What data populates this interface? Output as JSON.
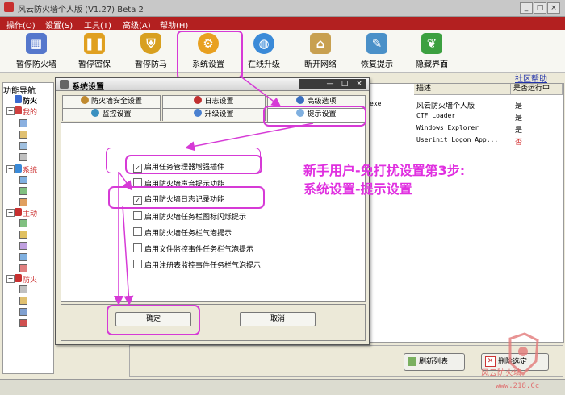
{
  "window": {
    "title": "风云防火墙个人版  (V1.27)  Beta 2",
    "controls": [
      "_",
      "□",
      "×"
    ]
  },
  "menu": [
    "操作(O)",
    "设置(S)",
    "工具(T)",
    "高级(A)",
    "帮助(H)"
  ],
  "toolbar": [
    {
      "label": "暂停防火墙",
      "icon": "firewall-pause-icon",
      "color": "#5577cc"
    },
    {
      "label": "暂停密保",
      "icon": "password-pause-icon",
      "color": "#e0a020"
    },
    {
      "label": "暂停防马",
      "icon": "shield-icon",
      "color": "#d8a020"
    },
    {
      "label": "系统设置",
      "icon": "gear-icon",
      "color": "#e8a020"
    },
    {
      "label": "在线升级",
      "icon": "globe-icon",
      "color": "#3a8ad8"
    },
    {
      "label": "断开网络",
      "icon": "network-icon",
      "color": "#c8a050"
    },
    {
      "label": "恢复提示",
      "icon": "restore-icon",
      "color": "#4a90c8"
    },
    {
      "label": "隐藏界面",
      "icon": "leaf-icon",
      "color": "#3ca040"
    }
  ],
  "community_help": "社区帮助",
  "nav": {
    "title": "功能导航",
    "nodes": [
      "防火",
      "我的",
      "系统",
      "主动",
      "防火"
    ]
  },
  "list": {
    "headers": [
      "描述",
      "是否运行中"
    ],
    "rows": [
      {
        "file": "exe",
        "desc": "风云防火墙个人版",
        "running": "是"
      },
      {
        "file": "",
        "desc": "CTF Loader",
        "running": "是"
      },
      {
        "file": "",
        "desc": "Windows Explorer",
        "running": "是"
      },
      {
        "file": "",
        "desc": "Userinit Logon App...",
        "running": "否"
      }
    ]
  },
  "bottom_buttons": {
    "refresh": "刷新列表",
    "delete": "删除选定"
  },
  "dialog": {
    "title": "系统设置",
    "controls": [
      "—",
      "□",
      "×"
    ],
    "tabs_row1": [
      "防火墙安全设置",
      "日志设置",
      "高级选项"
    ],
    "tabs_row2": [
      "监控设置",
      "升级设置",
      "提示设置"
    ],
    "options": [
      {
        "label": "启用任务管理器增强插件",
        "checked": true
      },
      {
        "label": "启用防火墙声音提示功能",
        "checked": false
      },
      {
        "label": "启用防火墙日志记录功能",
        "checked": true
      },
      {
        "label": "启用防火墙任务栏图标闪烁提示",
        "checked": false
      },
      {
        "label": "启用防火墙任务栏气泡提示",
        "checked": false
      },
      {
        "label": "启用文件监控事件任务栏气泡提示",
        "checked": false
      },
      {
        "label": "启用注册表监控事件任务栏气泡提示",
        "checked": false
      }
    ],
    "ok": "确定",
    "cancel": "取消"
  },
  "annotation": {
    "line1": "新手用户-免打扰设置第3步:",
    "line2": "系统设置-提示设置"
  },
  "watermark": {
    "text": "风云防火墙",
    "url": "www.218.Cc"
  },
  "colors": {
    "menubar": "#b32020",
    "highlight": "#d63ad6",
    "annotation": "#e030e0"
  }
}
